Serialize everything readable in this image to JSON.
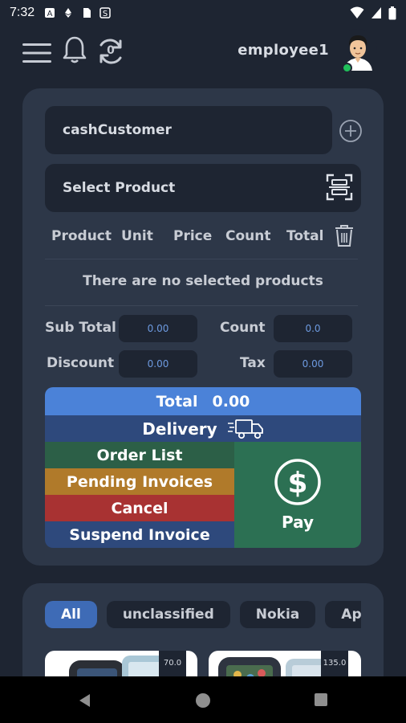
{
  "status_bar": {
    "time": "7:32"
  },
  "app_bar": {
    "username": "employee1",
    "notification_count": "0"
  },
  "order": {
    "customer": "cashCustomer",
    "product_placeholder": "Select Product",
    "columns": [
      "Product",
      "Unit",
      "Price",
      "Count",
      "Total"
    ],
    "empty_message": "There are no selected products",
    "summary": {
      "subtotal_label": "Sub Total",
      "subtotal_value": "0.00",
      "count_label": "Count",
      "count_value": "0.0",
      "discount_label": "Discount",
      "discount_value": "0.00",
      "tax_label": "Tax",
      "tax_value": "0.00"
    },
    "total_label": "Total",
    "total_value": "0.00",
    "delivery_label": "Delivery",
    "actions": {
      "order_list": "Order List",
      "pending_invoices": "Pending Invoices",
      "cancel": "Cancel",
      "suspend_invoice": "Suspend Invoice",
      "pay": "Pay"
    }
  },
  "catalog": {
    "categories": [
      "All",
      "unclassified",
      "Nokia",
      "App"
    ],
    "products": [
      {
        "price": "70.0"
      },
      {
        "price": "135.0"
      }
    ]
  },
  "colors": {
    "background": "#1e2532",
    "card": "#2d3748",
    "total": "#4b82d8",
    "delivery": "#2e497c",
    "order_list": "#2c5f47",
    "pending": "#b07a2a",
    "cancel": "#a83232",
    "suspend": "#2e497c",
    "pay": "#2c7053",
    "accent_value": "#6d9ae0"
  }
}
